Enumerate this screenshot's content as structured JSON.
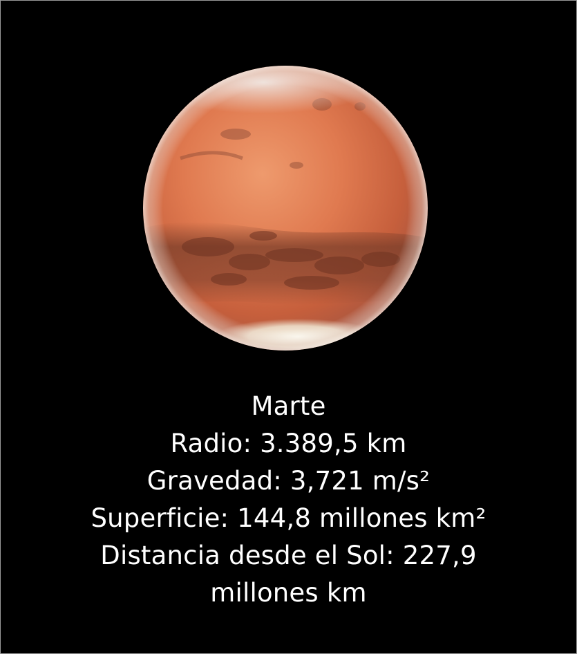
{
  "planet": {
    "name": "Marte",
    "icon": "mars-planet-image",
    "colors": {
      "background": "#000000",
      "surface": "#d9714a",
      "surface_light": "#e58d64",
      "dark_region": "#7a3e2a",
      "polar_cap": "#f2f0e8",
      "haze": "#d7d4d8"
    }
  },
  "facts": {
    "radius": "Radio: 3.389,5 km",
    "gravity": "Gravedad: 3,721 m/s²",
    "surface": "Superficie: 144,8 millones km²",
    "distance": "Distancia desde el Sol: 227,9 millones km"
  }
}
